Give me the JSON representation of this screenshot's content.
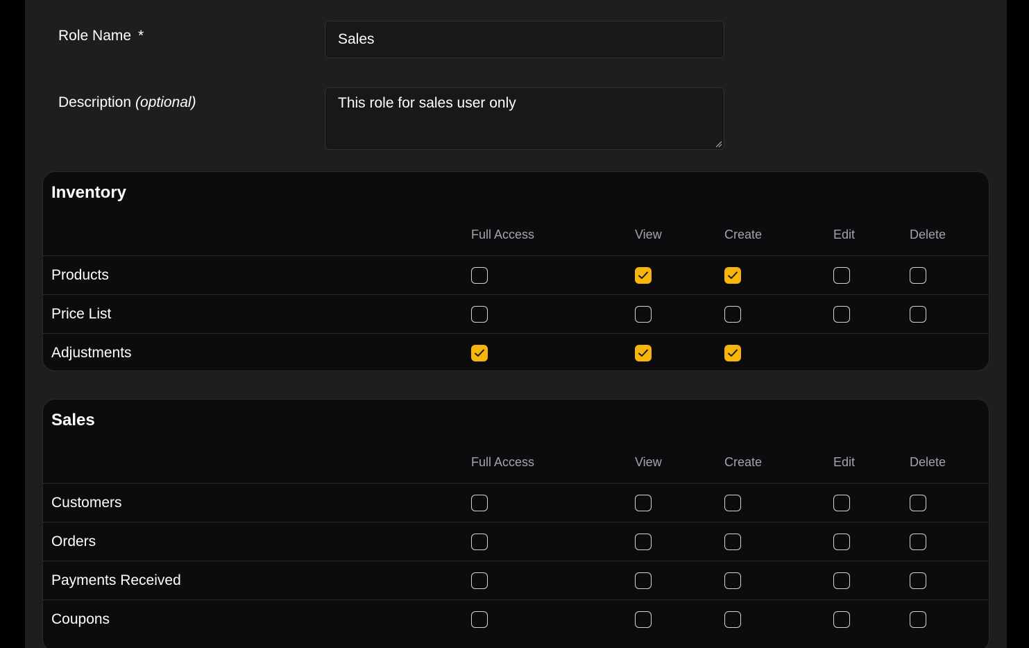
{
  "form": {
    "role_name_label": "Role Name",
    "required_mark": "*",
    "role_name_value": "Sales",
    "description_label": "Description",
    "optional_mark": "(optional)",
    "description_value": "This role for sales user only"
  },
  "columns": [
    "Full Access",
    "View",
    "Create",
    "Edit",
    "Delete"
  ],
  "accent_color": "#f5b50a",
  "sections": [
    {
      "title": "Inventory",
      "rows": [
        {
          "label": "Products",
          "perms": [
            false,
            true,
            true,
            false,
            false
          ],
          "has": [
            true,
            true,
            true,
            true,
            true
          ]
        },
        {
          "label": "Price List",
          "perms": [
            false,
            false,
            false,
            false,
            false
          ],
          "has": [
            true,
            true,
            true,
            true,
            true
          ]
        },
        {
          "label": "Adjustments",
          "perms": [
            true,
            true,
            true,
            false,
            false
          ],
          "has": [
            true,
            true,
            true,
            false,
            false
          ]
        }
      ]
    },
    {
      "title": "Sales",
      "rows": [
        {
          "label": "Customers",
          "perms": [
            false,
            false,
            false,
            false,
            false
          ],
          "has": [
            true,
            true,
            true,
            true,
            true
          ]
        },
        {
          "label": "Orders",
          "perms": [
            false,
            false,
            false,
            false,
            false
          ],
          "has": [
            true,
            true,
            true,
            true,
            true
          ]
        },
        {
          "label": "Payments Received",
          "perms": [
            false,
            false,
            false,
            false,
            false
          ],
          "has": [
            true,
            true,
            true,
            true,
            true
          ]
        },
        {
          "label": "Coupons",
          "perms": [
            false,
            false,
            false,
            false,
            false
          ],
          "has": [
            true,
            true,
            true,
            true,
            true
          ]
        }
      ]
    }
  ]
}
